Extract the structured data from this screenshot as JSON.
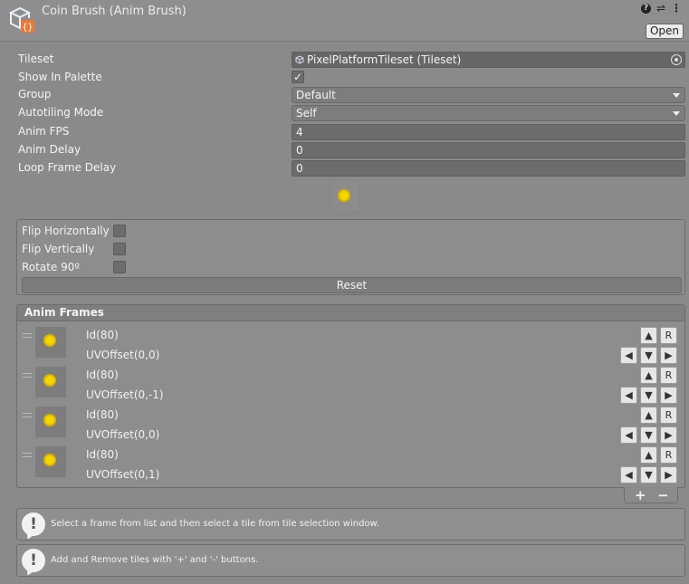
{
  "header": {
    "title": "Coin Brush (Anim Brush)",
    "open_label": "Open"
  },
  "properties": {
    "tileset_label": "Tileset",
    "tileset_value": "PixelPlatformTileset (Tileset)",
    "show_in_palette_label": "Show In Palette",
    "show_in_palette_checked": "✓",
    "group_label": "Group",
    "group_value": "Default",
    "autotiling_label": "Autotiling Mode",
    "autotiling_value": "Self",
    "anim_fps_label": "Anim FPS",
    "anim_fps_value": "4",
    "anim_delay_label": "Anim Delay",
    "anim_delay_value": "0",
    "loop_frame_delay_label": "Loop Frame Delay",
    "loop_frame_delay_value": "0"
  },
  "flips": {
    "flip_h_label": "Flip Horizontally",
    "flip_v_label": "Flip Vertically",
    "rotate_label": "Rotate 90º",
    "reset_label": "Reset"
  },
  "anim_frames": {
    "title": "Anim Frames",
    "frames": [
      {
        "id": "Id(80)",
        "uv": "UVOffset(0,0)"
      },
      {
        "id": "Id(80)",
        "uv": "UVOffset(0,-1)"
      },
      {
        "id": "Id(80)",
        "uv": "UVOffset(0,0)"
      },
      {
        "id": "Id(80)",
        "uv": "UVOffset(0,1)"
      }
    ],
    "up_glyph": "▲",
    "down_glyph": "▼",
    "left_glyph": "◀",
    "right_glyph": "▶",
    "reset_glyph": "R",
    "add_glyph": "+",
    "remove_glyph": "−"
  },
  "help": {
    "msg1": "Select a frame from list and then select a tile from tile selection window.",
    "msg2": "Add and Remove tiles with '+' and '-' buttons.",
    "warn_glyph": "!"
  },
  "colors": {
    "coin": "#f4d500",
    "background": "#8a8a8a"
  }
}
